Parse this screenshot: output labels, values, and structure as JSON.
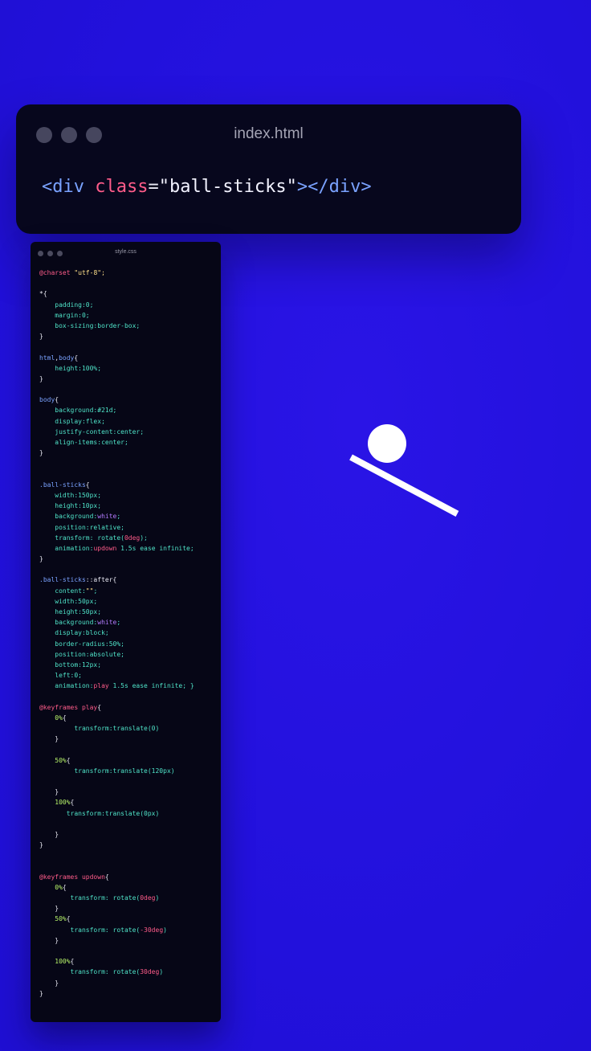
{
  "html_window": {
    "title": "index.html",
    "code": {
      "open_tag": "<div",
      "attr": "class",
      "eq": "=",
      "value": "\"ball-sticks\"",
      "close": "></div>"
    }
  },
  "css_window": {
    "title": "style.css",
    "lines": [
      [
        [
          "kw",
          "@charset "
        ],
        [
          "str",
          "\"utf-8\";"
        ]
      ],
      [],
      [
        [
          "plain",
          "*{"
        ]
      ],
      [
        [
          "prop",
          "    padding:0;"
        ]
      ],
      [
        [
          "prop",
          "    margin:0;"
        ]
      ],
      [
        [
          "prop",
          "    box-sizing:border-box;"
        ]
      ],
      [
        [
          "plain",
          "}"
        ]
      ],
      [],
      [
        [
          "sel",
          "html"
        ],
        [
          "plain",
          ","
        ],
        [
          "sel",
          "body"
        ],
        [
          "plain",
          "{"
        ]
      ],
      [
        [
          "prop",
          "    height:100%;"
        ]
      ],
      [
        [
          "plain",
          "}"
        ]
      ],
      [],
      [
        [
          "sel",
          "body"
        ],
        [
          "plain",
          "{"
        ]
      ],
      [
        [
          "prop",
          "    background:#21d;"
        ]
      ],
      [
        [
          "prop",
          "    display:flex;"
        ]
      ],
      [
        [
          "prop",
          "    justify-content:center;"
        ]
      ],
      [
        [
          "prop",
          "    align-items:center;"
        ]
      ],
      [
        [
          "plain",
          "}"
        ]
      ],
      [],
      [],
      [
        [
          "sel",
          ".ball-sticks"
        ],
        [
          "plain",
          "{"
        ]
      ],
      [
        [
          "prop",
          "    width:150px;"
        ]
      ],
      [
        [
          "prop",
          "    height:10px;"
        ]
      ],
      [
        [
          "prop",
          "    background:"
        ],
        [
          "white",
          "white"
        ],
        [
          "prop",
          ";"
        ]
      ],
      [
        [
          "prop",
          "    position:relative;"
        ]
      ],
      [
        [
          "prop",
          "    transform: rotate("
        ],
        [
          "pink",
          "0deg"
        ],
        [
          "prop",
          ");"
        ]
      ],
      [
        [
          "prop",
          "    animation:"
        ],
        [
          "pink",
          "updown"
        ],
        [
          "prop",
          " 1.5s ease infinite;"
        ]
      ],
      [
        [
          "plain",
          "}"
        ]
      ],
      [],
      [
        [
          "sel",
          ".ball-sticks"
        ],
        [
          "plain",
          "::after{"
        ]
      ],
      [
        [
          "prop",
          "    content:"
        ],
        [
          "str",
          "\"\""
        ],
        [
          "prop",
          ";"
        ]
      ],
      [
        [
          "prop",
          "    width:50px;"
        ]
      ],
      [
        [
          "prop",
          "    height:50px;"
        ]
      ],
      [
        [
          "prop",
          "    background:"
        ],
        [
          "white",
          "white"
        ],
        [
          "prop",
          ";"
        ]
      ],
      [
        [
          "prop",
          "    display:block;"
        ]
      ],
      [
        [
          "prop",
          "    border-radius:50%;"
        ]
      ],
      [
        [
          "prop",
          "    position:absolute;"
        ]
      ],
      [
        [
          "prop",
          "    bottom:12px;"
        ]
      ],
      [
        [
          "prop",
          "    left:0;"
        ]
      ],
      [
        [
          "prop",
          "    animation:"
        ],
        [
          "pink",
          "play"
        ],
        [
          "prop",
          " 1.5s ease infinite; }"
        ]
      ],
      [],
      [
        [
          "kw",
          "@keyframes play"
        ],
        [
          "plain",
          "{"
        ]
      ],
      [
        [
          "pct",
          "    0%"
        ],
        [
          "plain",
          "{"
        ]
      ],
      [
        [
          "prop",
          "         transform:translate(0)"
        ]
      ],
      [
        [
          "plain",
          "    }"
        ]
      ],
      [],
      [
        [
          "pct",
          "    50%"
        ],
        [
          "plain",
          "{"
        ]
      ],
      [
        [
          "prop",
          "         transform:translate(120px)"
        ]
      ],
      [],
      [
        [
          "plain",
          "    }"
        ]
      ],
      [
        [
          "pct",
          "    100%"
        ],
        [
          "plain",
          "{"
        ]
      ],
      [
        [
          "prop",
          "       transform:translate(0px)"
        ]
      ],
      [],
      [
        [
          "plain",
          "    }"
        ]
      ],
      [
        [
          "plain",
          "}"
        ]
      ],
      [],
      [],
      [
        [
          "kw",
          "@keyframes updown"
        ],
        [
          "plain",
          "{"
        ]
      ],
      [
        [
          "pct",
          "    0%"
        ],
        [
          "plain",
          "{"
        ]
      ],
      [
        [
          "prop",
          "        transform: rotate("
        ],
        [
          "pink",
          "0deg"
        ],
        [
          "prop",
          ")"
        ]
      ],
      [
        [
          "plain",
          "    }"
        ]
      ],
      [
        [
          "pct",
          "    50%"
        ],
        [
          "plain",
          "{"
        ]
      ],
      [
        [
          "prop",
          "        transform: rotate("
        ],
        [
          "pink",
          "-30deg"
        ],
        [
          "prop",
          ")"
        ]
      ],
      [
        [
          "plain",
          "    }"
        ]
      ],
      [],
      [
        [
          "pct",
          "    100%"
        ],
        [
          "plain",
          "{"
        ]
      ],
      [
        [
          "prop",
          "        transform: rotate("
        ],
        [
          "pink",
          "30deg"
        ],
        [
          "prop",
          ")"
        ]
      ],
      [
        [
          "plain",
          "    }"
        ]
      ],
      [
        [
          "plain",
          "}"
        ]
      ]
    ]
  },
  "colors": {
    "background": "#2211dc",
    "window": "#07071d",
    "ball": "#ffffff"
  }
}
